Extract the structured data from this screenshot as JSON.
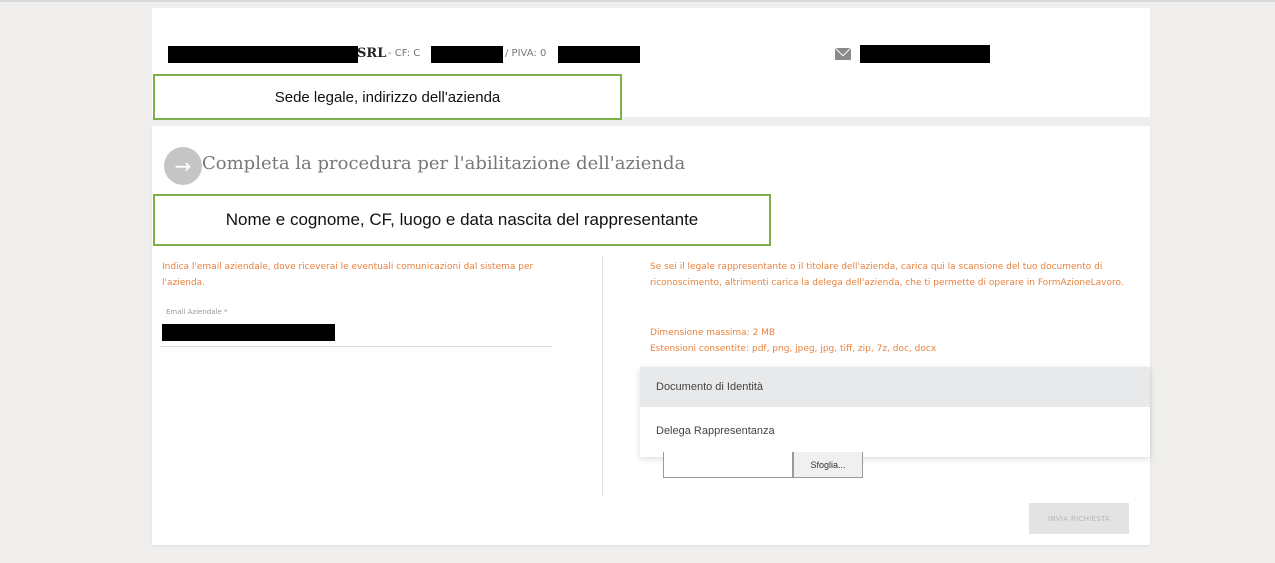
{
  "company": {
    "srl": "SRL",
    "cf_label": " - CF: C",
    "piva_label": "/ PIVA: 0"
  },
  "icons": {
    "mail": "envelope-icon",
    "arrow": "arrow-right-icon"
  },
  "annotations": {
    "sede": "Sede legale, indirizzo dell'azienda",
    "nome": "Nome e cognome, CF, luogo e data nascita del rappresentante"
  },
  "procedure_title": "Completa la procedura per l'abilitazione dell'azienda",
  "left": {
    "info": "Indica l'email aziendale, dove riceverai le eventuali comunicazioni dal sistema per l'azienda.",
    "email_label": "Email Aziendale *"
  },
  "right": {
    "info": "Se sei il legale rappresentante o il titolare dell'azienda, carica qui la scansione del tuo documento di riconoscimento, altrimenti carica la delega dell'azienda, che ti permette di operare in FormAzioneLavoro.",
    "max_size": "Dimensione massima: 2 MB",
    "extensions": "Estensioni consentite: pdf, png, jpeg, jpg, tiff, zip, 7z, doc, docx"
  },
  "dropdown": {
    "options": [
      "Documento di Identità",
      "Delega Rappresentanza"
    ]
  },
  "browse_label": "Sfoglia...",
  "submit_label": "INVIA RICHIESTA",
  "colors": {
    "accent_orange": "#e8823e",
    "annotation_border": "#7db04a"
  }
}
